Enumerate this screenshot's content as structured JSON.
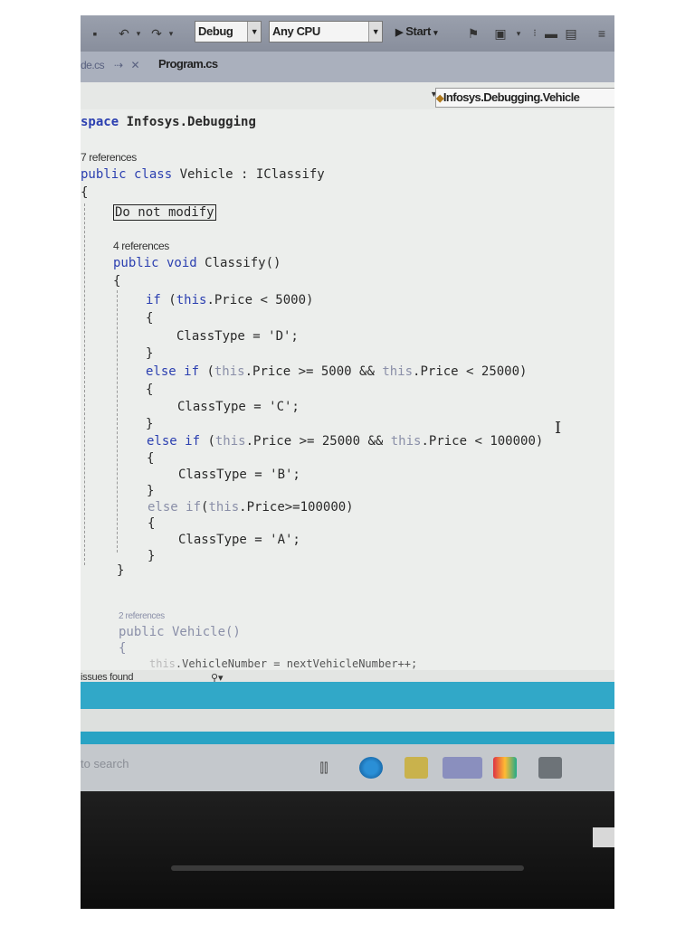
{
  "toolbar": {
    "config": "Debug",
    "platform": "Any CPU",
    "start_label": "Start"
  },
  "tabs": [
    {
      "label": "de.cs"
    },
    {
      "label": "Program.cs"
    }
  ],
  "navbar": {
    "member_combo": "Infosys.Debugging.Vehicle"
  },
  "code": {
    "namespace_kw": "space",
    "namespace_name": " Infosys.Debugging",
    "refs_class": "7 references",
    "class_public": "public",
    "class_kw": " class",
    "class_name": " Vehicle : IClassify",
    "brace_open": "{",
    "collapsed_region": "Do not modify",
    "refs_method": "4 references",
    "m_public": "public",
    "m_void": " void",
    "m_name": " Classify()",
    "m_brace_open": "{",
    "if1_kw": "if",
    "if1_open": " (",
    "if1_this": "this",
    "if1_cond": ".Price < 5000)",
    "b1_open": "{",
    "ct_d": "ClassType = 'D';",
    "b1_close": "}",
    "else1": "else if",
    "if2_open": " (",
    "if2_this1": "this",
    "if2_mid": ".Price >= 5000 && ",
    "if2_this2": "this",
    "if2_end": ".Price < 25000)",
    "b2_open": "{",
    "ct_c": "ClassType = 'C';",
    "b2_close": "}",
    "else2": "else if",
    "if3_open": " (",
    "if3_this1": "this",
    "if3_mid": ".Price >= 25000 && ",
    "if3_this2": "this",
    "if3_end": ".Price < 100000)",
    "b3_open": "{",
    "ct_b": "ClassType = 'B';",
    "b3_close": "}",
    "else3": "else if",
    "if4_open": "(",
    "if4_this": "this",
    "if4_end": ".Price>=100000)",
    "b4_open": "{",
    "ct_a": "ClassType = 'A';",
    "b4_close": "}",
    "m_brace_close": "}",
    "refs_ctor": "2 references",
    "ctor_public": "public",
    "ctor_name": " Vehicle()",
    "ctor_brace": "{",
    "ctor_this": "this",
    "ctor_body": ".VehicleNumber = nextVehicleNumber++;"
  },
  "status": {
    "issues": "issues found"
  },
  "taskbar": {
    "search_placeholder": "to search"
  }
}
